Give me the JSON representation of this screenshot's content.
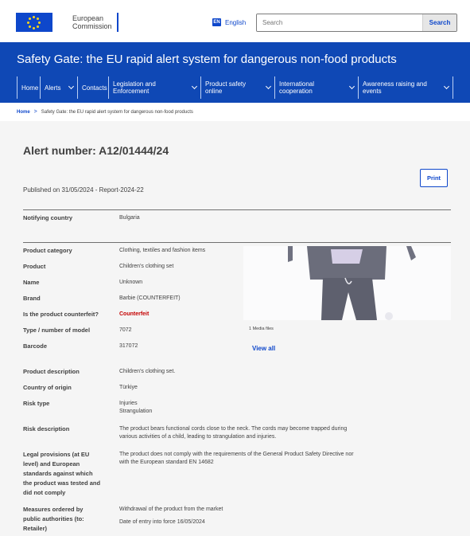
{
  "header": {
    "logo_text_line1": "European",
    "logo_text_line2": "Commission",
    "language_code": "EN",
    "language_label": "English",
    "search_placeholder": "Search",
    "search_button": "Search"
  },
  "site": {
    "title": "Safety Gate: the EU rapid alert system for dangerous non-food products"
  },
  "nav": [
    {
      "line1": "Home",
      "line2": ""
    },
    {
      "line1": "Alerts",
      "line2": ""
    },
    {
      "line1": "Contacts",
      "line2": ""
    },
    {
      "line1": "Legislation and",
      "line2": "Enforcement"
    },
    {
      "line1": "Product safety",
      "line2": "online"
    },
    {
      "line1": "International",
      "line2": "cooperation"
    },
    {
      "line1": "Awareness raising and",
      "line2": "events"
    }
  ],
  "breadcrumb": {
    "home": "Home",
    "separator": ">",
    "current": "Safety Gate: the EU rapid alert system for dangerous non-food products"
  },
  "alert": {
    "title": "Alert number: A12/01444/24",
    "published": "Published on 31/05/2024 - Report-2024-22",
    "print_label": "Print",
    "media_count": "1 Media files",
    "view_all": "View all"
  },
  "details": {
    "notifying_country_label": "Notifying country",
    "notifying_country": "Bulgaria",
    "product_category_label": "Product category",
    "product_category": "Clothing, textiles and fashion items",
    "product_label": "Product",
    "product": "Children's clothing set",
    "name_label": "Name",
    "name": "Unknown",
    "brand_label": "Brand",
    "brand": "Barbie (COUNTERFEIT)",
    "counterfeit_label": "Is the product counterfeit?",
    "counterfeit": "Counterfeit",
    "type_label": "Type / number of model",
    "type": "7072",
    "barcode_label": "Barcode",
    "barcode": "317072",
    "description_label": "Product description",
    "description": "Children's clothing set.",
    "origin_label": "Country of origin",
    "origin": "Türkiye",
    "risk_type_label": "Risk type",
    "risk_type_1": "Injuries",
    "risk_type_2": "Strangulation",
    "risk_desc_label": "Risk description",
    "risk_desc_1": "The product bears functional cords close to the neck. The cords may become trapped during",
    "risk_desc_2": "various activities of a child, leading to strangulation and injuries.",
    "legal_label_1": "Legal provisions (at EU",
    "legal_label_2": "level) and European",
    "legal_label_3": "standards against which",
    "legal_label_4": "the product was tested and",
    "legal_label_5": "did not comply",
    "legal_1": "The product does not comply with the requirements of the General Product Safety Directive nor",
    "legal_2": "with the European standard EN 14682",
    "measures_label_1": "Measures ordered by",
    "measures_label_2": "public authorities (to:",
    "measures_label_3": "Retailer)",
    "measures_1": "Withdrawal of the product from the market",
    "measures_2": "Date of entry into force 16/05/2024"
  },
  "colors": {
    "ec_blue": "#0e47cb",
    "banner_blue": "#0f48b5",
    "counterfeit_red": "#c40000"
  }
}
